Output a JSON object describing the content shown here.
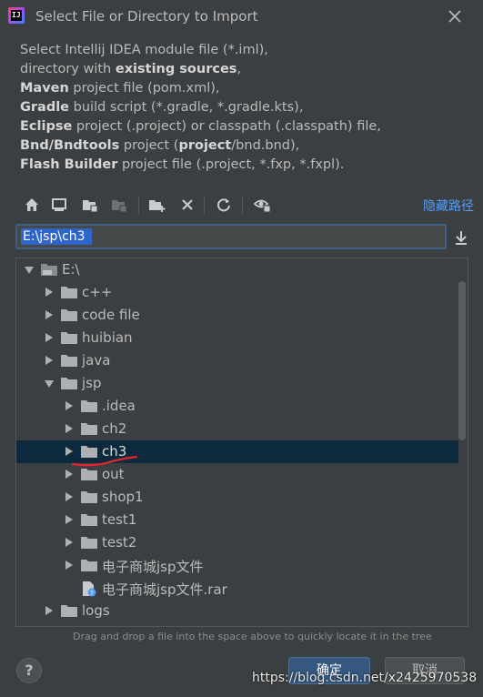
{
  "window": {
    "title": "Select File or Directory to Import"
  },
  "description": {
    "lines": [
      [
        {
          "t": "Select Intellij IDEA module file (*.iml),",
          "b": false
        }
      ],
      [
        {
          "t": "directory with ",
          "b": false
        },
        {
          "t": "existing sources",
          "b": true
        },
        {
          "t": ",",
          "b": false
        }
      ],
      [
        {
          "t": "Maven",
          "b": true
        },
        {
          "t": " project file (pom.xml),",
          "b": false
        }
      ],
      [
        {
          "t": "Gradle",
          "b": true
        },
        {
          "t": " build script (*.gradle, *.gradle.kts),",
          "b": false
        }
      ],
      [
        {
          "t": "Eclipse",
          "b": true
        },
        {
          "t": " project (.project) or classpath (.classpath) file,",
          "b": false
        }
      ],
      [
        {
          "t": "Bnd/Bndtools",
          "b": true
        },
        {
          "t": " project (",
          "b": false
        },
        {
          "t": "project",
          "b": true
        },
        {
          "t": "/bnd.bnd),",
          "b": false
        }
      ],
      [
        {
          "t": "Flash Builder",
          "b": true
        },
        {
          "t": " project file (.project, *.fxp, *.fxpl).",
          "b": false
        }
      ]
    ]
  },
  "toolbar": {
    "icons": [
      "home-icon",
      "desktop-icon",
      "project-folder-icon",
      "module-folder-icon",
      "new-folder-icon",
      "delete-icon",
      "refresh-icon",
      "show-hidden-icon"
    ],
    "hide_path_label": "隐藏路径"
  },
  "path_field": {
    "value": "E:\\jsp\\ch3"
  },
  "tree": {
    "rows": [
      {
        "label": "E:\\",
        "level": 0,
        "expanded": true,
        "type": "drive"
      },
      {
        "label": "c++",
        "level": 1,
        "expanded": false,
        "type": "folder"
      },
      {
        "label": "code file",
        "level": 1,
        "expanded": false,
        "type": "folder"
      },
      {
        "label": "huibian",
        "level": 1,
        "expanded": false,
        "type": "folder"
      },
      {
        "label": "java",
        "level": 1,
        "expanded": false,
        "type": "folder"
      },
      {
        "label": "jsp",
        "level": 1,
        "expanded": true,
        "type": "folder"
      },
      {
        "label": ".idea",
        "level": 2,
        "expanded": false,
        "type": "folder"
      },
      {
        "label": "ch2",
        "level": 2,
        "expanded": false,
        "type": "folder"
      },
      {
        "label": "ch3",
        "level": 2,
        "expanded": false,
        "type": "folder",
        "selected": true
      },
      {
        "label": "out",
        "level": 2,
        "expanded": false,
        "type": "folder"
      },
      {
        "label": "shop1",
        "level": 2,
        "expanded": false,
        "type": "folder"
      },
      {
        "label": "test1",
        "level": 2,
        "expanded": false,
        "type": "folder"
      },
      {
        "label": "test2",
        "level": 2,
        "expanded": false,
        "type": "folder"
      },
      {
        "label": "电子商城jsp文件",
        "level": 2,
        "expanded": false,
        "type": "folder"
      },
      {
        "label": "电子商城jsp文件.rar",
        "level": 2,
        "type": "file"
      },
      {
        "label": "logs",
        "level": 1,
        "expanded": false,
        "type": "folder"
      }
    ]
  },
  "hint": "Drag and drop a file into the space above to quickly locate it in the tree",
  "buttons": {
    "help": "?",
    "ok": "确定",
    "cancel": "取消"
  },
  "watermark": "https://blog.csdn.net/x2425970538",
  "colors": {
    "accent": "#589df6",
    "selection": "#0d293e",
    "ok": "#365880",
    "annotation": "#e8262a"
  }
}
